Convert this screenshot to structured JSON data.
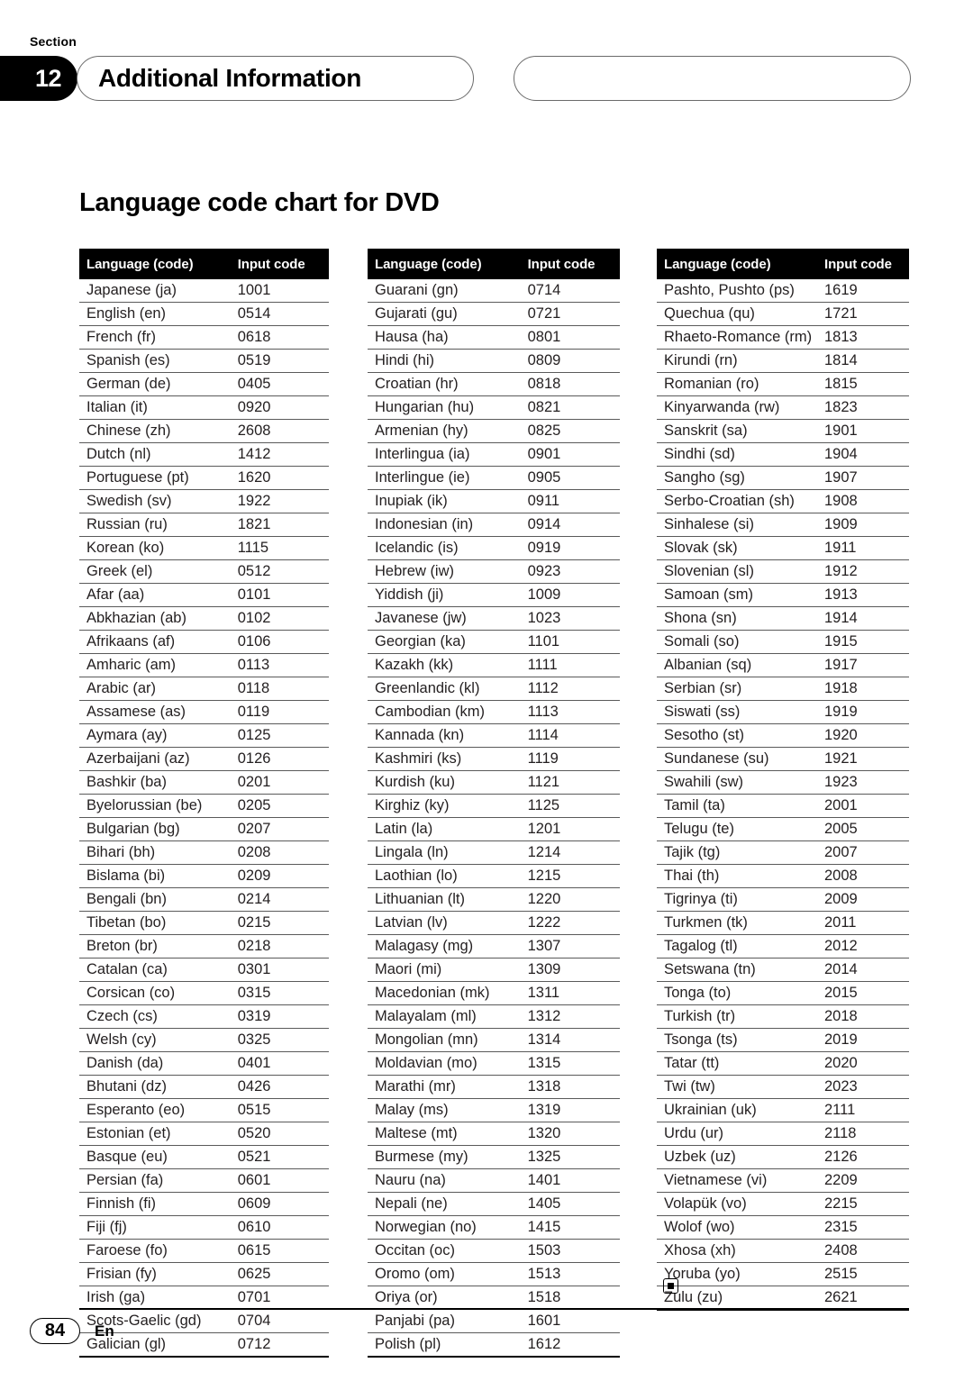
{
  "header": {
    "section_label": "Section",
    "section_number": "12",
    "title": "Additional Information",
    "right_pill_text": ""
  },
  "page_heading": "Language code chart for DVD",
  "table_headers": {
    "language": "Language (code)",
    "input_code": "Input code"
  },
  "end_marker": "filled-square-marker",
  "footer": {
    "page_number": "84",
    "language_mark": "En"
  },
  "columns": [
    {
      "id": "col0",
      "rows": [
        {
          "language": "Japanese (ja)",
          "code": "1001"
        },
        {
          "language": "English (en)",
          "code": "0514"
        },
        {
          "language": "French (fr)",
          "code": "0618"
        },
        {
          "language": "Spanish (es)",
          "code": "0519"
        },
        {
          "language": "German (de)",
          "code": "0405"
        },
        {
          "language": "Italian (it)",
          "code": "0920"
        },
        {
          "language": "Chinese (zh)",
          "code": "2608"
        },
        {
          "language": "Dutch (nl)",
          "code": "1412"
        },
        {
          "language": "Portuguese (pt)",
          "code": "1620"
        },
        {
          "language": "Swedish (sv)",
          "code": "1922"
        },
        {
          "language": "Russian (ru)",
          "code": "1821"
        },
        {
          "language": "Korean (ko)",
          "code": "1115"
        },
        {
          "language": "Greek (el)",
          "code": "0512"
        },
        {
          "language": "Afar (aa)",
          "code": "0101"
        },
        {
          "language": "Abkhazian (ab)",
          "code": "0102"
        },
        {
          "language": "Afrikaans (af)",
          "code": "0106"
        },
        {
          "language": "Amharic (am)",
          "code": "0113"
        },
        {
          "language": "Arabic (ar)",
          "code": "0118"
        },
        {
          "language": "Assamese (as)",
          "code": "0119"
        },
        {
          "language": "Aymara (ay)",
          "code": "0125"
        },
        {
          "language": "Azerbaijani (az)",
          "code": "0126"
        },
        {
          "language": "Bashkir (ba)",
          "code": "0201"
        },
        {
          "language": "Byelorussian (be)",
          "code": "0205"
        },
        {
          "language": "Bulgarian (bg)",
          "code": "0207"
        },
        {
          "language": "Bihari (bh)",
          "code": "0208"
        },
        {
          "language": "Bislama (bi)",
          "code": "0209"
        },
        {
          "language": "Bengali (bn)",
          "code": "0214"
        },
        {
          "language": "Tibetan (bo)",
          "code": "0215"
        },
        {
          "language": "Breton (br)",
          "code": "0218"
        },
        {
          "language": "Catalan (ca)",
          "code": "0301"
        },
        {
          "language": "Corsican (co)",
          "code": "0315"
        },
        {
          "language": "Czech (cs)",
          "code": "0319"
        },
        {
          "language": "Welsh (cy)",
          "code": "0325"
        },
        {
          "language": "Danish (da)",
          "code": "0401"
        },
        {
          "language": "Bhutani (dz)",
          "code": "0426"
        },
        {
          "language": "Esperanto (eo)",
          "code": "0515"
        },
        {
          "language": "Estonian (et)",
          "code": "0520"
        },
        {
          "language": "Basque (eu)",
          "code": "0521"
        },
        {
          "language": "Persian (fa)",
          "code": "0601"
        },
        {
          "language": "Finnish (fi)",
          "code": "0609"
        },
        {
          "language": "Fiji (fj)",
          "code": "0610"
        },
        {
          "language": "Faroese (fo)",
          "code": "0615"
        },
        {
          "language": "Frisian (fy)",
          "code": "0625"
        },
        {
          "language": "Irish (ga)",
          "code": "0701"
        },
        {
          "language": "Scots-Gaelic (gd)",
          "code": "0704"
        },
        {
          "language": "Galician (gl)",
          "code": "0712"
        }
      ]
    },
    {
      "id": "col1",
      "rows": [
        {
          "language": "Guarani (gn)",
          "code": "0714"
        },
        {
          "language": "Gujarati (gu)",
          "code": "0721"
        },
        {
          "language": "Hausa (ha)",
          "code": "0801"
        },
        {
          "language": "Hindi (hi)",
          "code": "0809"
        },
        {
          "language": "Croatian (hr)",
          "code": "0818"
        },
        {
          "language": "Hungarian (hu)",
          "code": "0821"
        },
        {
          "language": "Armenian (hy)",
          "code": "0825"
        },
        {
          "language": "Interlingua (ia)",
          "code": "0901"
        },
        {
          "language": "Interlingue (ie)",
          "code": "0905"
        },
        {
          "language": "Inupiak (ik)",
          "code": "0911"
        },
        {
          "language": "Indonesian (in)",
          "code": "0914"
        },
        {
          "language": "Icelandic (is)",
          "code": "0919"
        },
        {
          "language": "Hebrew (iw)",
          "code": "0923"
        },
        {
          "language": "Yiddish (ji)",
          "code": "1009"
        },
        {
          "language": "Javanese (jw)",
          "code": "1023"
        },
        {
          "language": "Georgian (ka)",
          "code": "1101"
        },
        {
          "language": "Kazakh (kk)",
          "code": "1111"
        },
        {
          "language": "Greenlandic (kl)",
          "code": "1112"
        },
        {
          "language": "Cambodian (km)",
          "code": "1113"
        },
        {
          "language": "Kannada (kn)",
          "code": "1114"
        },
        {
          "language": "Kashmiri (ks)",
          "code": "1119"
        },
        {
          "language": "Kurdish (ku)",
          "code": "1121"
        },
        {
          "language": "Kirghiz (ky)",
          "code": "1125"
        },
        {
          "language": "Latin (la)",
          "code": "1201"
        },
        {
          "language": "Lingala (ln)",
          "code": "1214"
        },
        {
          "language": "Laothian (lo)",
          "code": "1215"
        },
        {
          "language": "Lithuanian (lt)",
          "code": "1220"
        },
        {
          "language": "Latvian (lv)",
          "code": "1222"
        },
        {
          "language": "Malagasy (mg)",
          "code": "1307"
        },
        {
          "language": "Maori (mi)",
          "code": "1309"
        },
        {
          "language": "Macedonian (mk)",
          "code": "1311"
        },
        {
          "language": "Malayalam (ml)",
          "code": "1312"
        },
        {
          "language": "Mongolian (mn)",
          "code": "1314"
        },
        {
          "language": "Moldavian (mo)",
          "code": "1315"
        },
        {
          "language": "Marathi (mr)",
          "code": "1318"
        },
        {
          "language": "Malay (ms)",
          "code": "1319"
        },
        {
          "language": "Maltese (mt)",
          "code": "1320"
        },
        {
          "language": "Burmese (my)",
          "code": "1325"
        },
        {
          "language": "Nauru (na)",
          "code": "1401"
        },
        {
          "language": "Nepali (ne)",
          "code": "1405"
        },
        {
          "language": "Norwegian (no)",
          "code": "1415"
        },
        {
          "language": "Occitan (oc)",
          "code": "1503"
        },
        {
          "language": "Oromo (om)",
          "code": "1513"
        },
        {
          "language": "Oriya (or)",
          "code": "1518"
        },
        {
          "language": "Panjabi (pa)",
          "code": "1601"
        },
        {
          "language": "Polish (pl)",
          "code": "1612"
        }
      ]
    },
    {
      "id": "col2",
      "rows": [
        {
          "language": "Pashto, Pushto (ps)",
          "code": "1619"
        },
        {
          "language": "Quechua (qu)",
          "code": "1721"
        },
        {
          "language": "Rhaeto-Romance (rm)",
          "code": "1813"
        },
        {
          "language": "Kirundi (rn)",
          "code": "1814"
        },
        {
          "language": "Romanian (ro)",
          "code": "1815"
        },
        {
          "language": "Kinyarwanda (rw)",
          "code": "1823"
        },
        {
          "language": "Sanskrit (sa)",
          "code": "1901"
        },
        {
          "language": "Sindhi (sd)",
          "code": "1904"
        },
        {
          "language": "Sangho (sg)",
          "code": "1907"
        },
        {
          "language": "Serbo-Croatian (sh)",
          "code": "1908"
        },
        {
          "language": "Sinhalese (si)",
          "code": "1909"
        },
        {
          "language": "Slovak (sk)",
          "code": "1911"
        },
        {
          "language": "Slovenian (sl)",
          "code": "1912"
        },
        {
          "language": "Samoan (sm)",
          "code": "1913"
        },
        {
          "language": "Shona (sn)",
          "code": "1914"
        },
        {
          "language": "Somali (so)",
          "code": "1915"
        },
        {
          "language": "Albanian (sq)",
          "code": "1917"
        },
        {
          "language": "Serbian (sr)",
          "code": "1918"
        },
        {
          "language": "Siswati (ss)",
          "code": "1919"
        },
        {
          "language": "Sesotho (st)",
          "code": "1920"
        },
        {
          "language": "Sundanese (su)",
          "code": "1921"
        },
        {
          "language": "Swahili (sw)",
          "code": "1923"
        },
        {
          "language": "Tamil (ta)",
          "code": "2001"
        },
        {
          "language": "Telugu (te)",
          "code": "2005"
        },
        {
          "language": "Tajik (tg)",
          "code": "2007"
        },
        {
          "language": "Thai (th)",
          "code": "2008"
        },
        {
          "language": "Tigrinya (ti)",
          "code": "2009"
        },
        {
          "language": "Turkmen (tk)",
          "code": "2011"
        },
        {
          "language": "Tagalog (tl)",
          "code": "2012"
        },
        {
          "language": "Setswana (tn)",
          "code": "2014"
        },
        {
          "language": "Tonga (to)",
          "code": "2015"
        },
        {
          "language": "Turkish (tr)",
          "code": "2018"
        },
        {
          "language": "Tsonga (ts)",
          "code": "2019"
        },
        {
          "language": "Tatar (tt)",
          "code": "2020"
        },
        {
          "language": "Twi (tw)",
          "code": "2023"
        },
        {
          "language": "Ukrainian (uk)",
          "code": "2111"
        },
        {
          "language": "Urdu (ur)",
          "code": "2118"
        },
        {
          "language": "Uzbek (uz)",
          "code": "2126"
        },
        {
          "language": "Vietnamese (vi)",
          "code": "2209"
        },
        {
          "language": "Volapük (vo)",
          "code": "2215"
        },
        {
          "language": "Wolof (wo)",
          "code": "2315"
        },
        {
          "language": "Xhosa (xh)",
          "code": "2408"
        },
        {
          "language": "Yoruba (yo)",
          "code": "2515"
        },
        {
          "language": "Zulu (zu)",
          "code": "2621"
        }
      ]
    }
  ]
}
